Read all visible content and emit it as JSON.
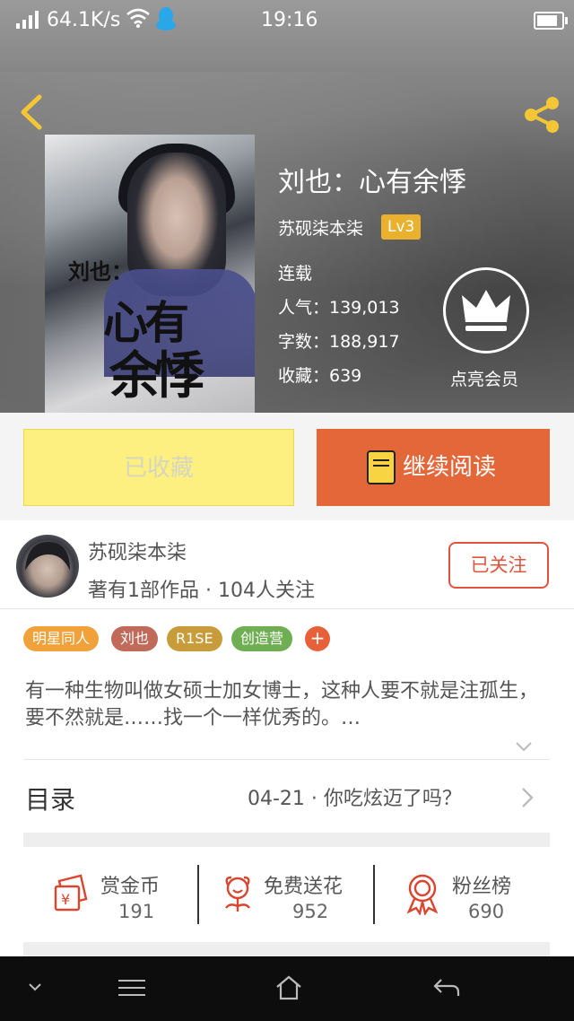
{
  "status_bar": {
    "speed": "64.1K/s",
    "time": "19:16"
  },
  "book": {
    "title": "刘也：心有余悸",
    "author": "苏砚柒本柒",
    "level": "Lv3",
    "status": "连载",
    "popularity": "人气：139,013",
    "words": "字数：188,917",
    "favorites": "收藏：639",
    "cover_text": {
      "line1": "刘也：",
      "line2": "心有",
      "line3": "余悸"
    }
  },
  "vip": {
    "label": "点亮会员"
  },
  "buttons": {
    "bookshelf": "已收藏",
    "continue_read": "继续阅读"
  },
  "author_info": {
    "name": "苏砚柒本柒",
    "meta": "著有1部作品 · 104人关注",
    "follow": "已关注"
  },
  "tags": [
    {
      "label": "明星同人",
      "color": "#f0a13a"
    },
    {
      "label": "刘也",
      "color": "#c06a5a"
    },
    {
      "label": "R1SE",
      "color": "#c89c3a"
    },
    {
      "label": "创造营",
      "color": "#6fae52"
    }
  ],
  "description": "有一种生物叫做女硕士加女博士，这种人要不就是注孤生，要不然就是……找一个一样优秀的。…",
  "toc": {
    "label": "目录",
    "latest": "04-21 · 你吃炫迈了吗？"
  },
  "actions": [
    {
      "label": "赏金币",
      "count": "191",
      "icon": "gold-coin-icon"
    },
    {
      "label": "免费送花",
      "count": "952",
      "icon": "flower-icon"
    },
    {
      "label": "粉丝榜",
      "count": "690",
      "icon": "award-ribbon-icon"
    }
  ],
  "colors": {
    "accent": "#e4673a",
    "follow": "#e0543d",
    "bookshelf": "#fdf080",
    "level_badge": "#e9b12e"
  }
}
